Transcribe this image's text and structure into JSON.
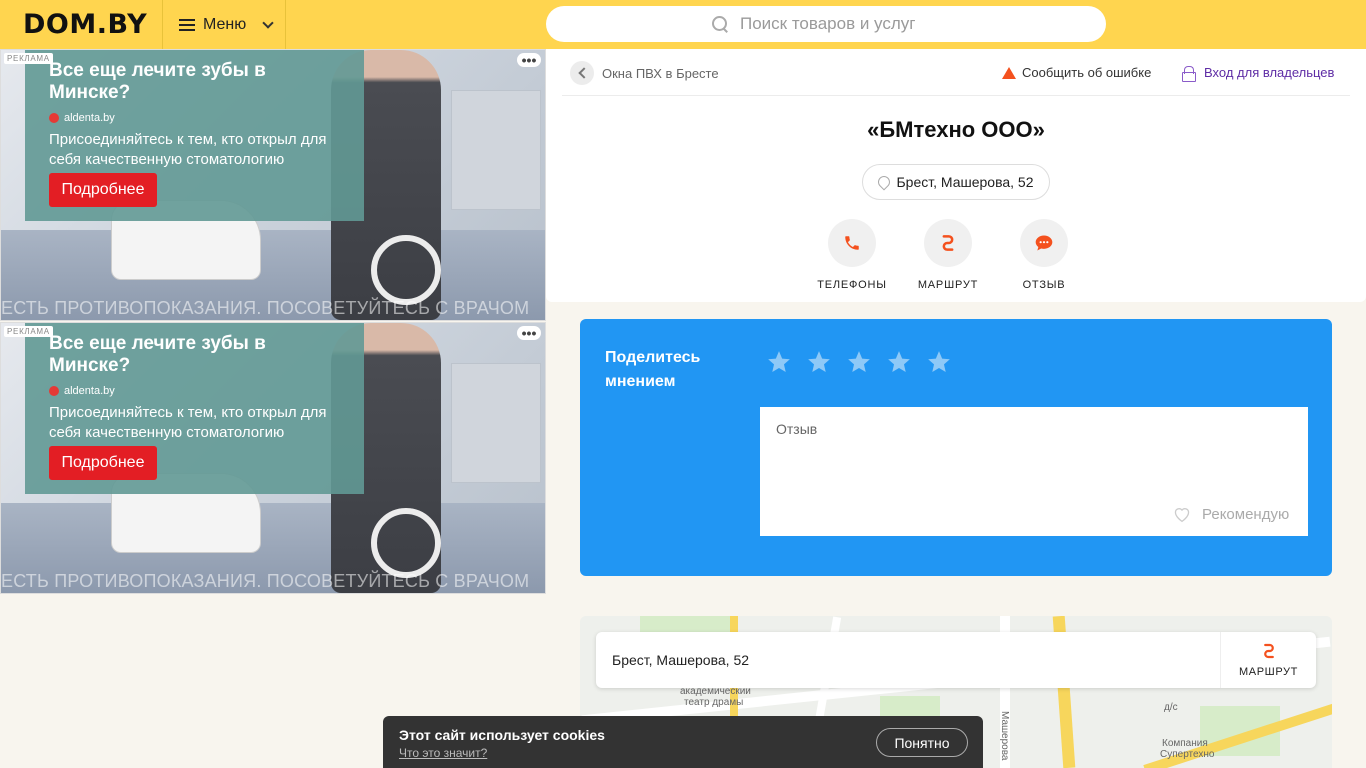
{
  "header": {
    "logo": "DOM.BY",
    "menu_label": "Меню",
    "search_placeholder": "Поиск товаров и услуг"
  },
  "ads": [
    {
      "label": "РЕКЛАМА",
      "title": "Все еще лечите зубы в Минске?",
      "site": "aldenta.by",
      "text": "Присоединяйтесь к тем, кто открыл для себя качественную стоматологию",
      "button": "Подробнее",
      "disclaimer": "ЕСТЬ ПРОТИВОПОКАЗАНИЯ. ПОСОВЕТУЙТЕСЬ С ВРАЧОМ",
      "menu_glyph": "•••"
    },
    {
      "label": "РЕКЛАМА",
      "title": "Все еще лечите зубы в Минске?",
      "site": "aldenta.by",
      "text": "Присоединяйтесь к тем, кто открыл для себя качественную стоматологию",
      "button": "Подробнее",
      "disclaimer": "ЕСТЬ ПРОТИВОПОКАЗАНИЯ. ПОСОВЕТУЙТЕСЬ С ВРАЧОМ",
      "menu_glyph": "•••"
    }
  ],
  "card": {
    "breadcrumb": "Окна ПВХ в Бресте",
    "report": "Сообщить об ошибке",
    "owner_login": "Вход для владельцев",
    "company": "«БМтехно ООО»",
    "address": "Брест, Машерова, 52",
    "actions": [
      {
        "label": "ТЕЛЕФОНЫ",
        "icon": "phone-icon"
      },
      {
        "label": "МАРШРУТ",
        "icon": "route-icon"
      },
      {
        "label": "ОТЗЫВ",
        "icon": "chat-icon"
      }
    ]
  },
  "review": {
    "title": "Поделитесь мнением",
    "placeholder": "Отзыв",
    "recommend": "Рекомендую",
    "stars_total": 5
  },
  "map": {
    "address": "Брест, Машерова, 52",
    "route": "МАРШРУТ",
    "labels": [
      "академический",
      "театр драмы",
      "Машерова",
      "Компания",
      "Супертехно",
      "д/с"
    ]
  },
  "cookie": {
    "title": "Этот сайт использует cookies",
    "link": "Что это значит?",
    "button": "Понятно"
  },
  "colors": {
    "header": "#ffd54f",
    "review_bg": "#2196f3",
    "accent_orange": "#f4511e",
    "ad_button": "#e31e24",
    "owner_link": "#5e2ca5"
  }
}
